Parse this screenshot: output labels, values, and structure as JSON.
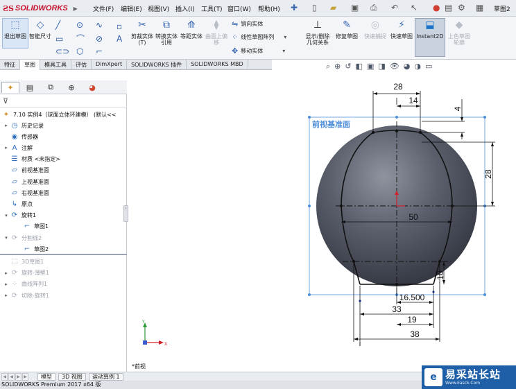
{
  "app": {
    "brand": "SOLIDWORKS",
    "document_name": "草图2",
    "brand_color": "#c8102e",
    "accent_color": "#1e5fa8"
  },
  "menu": {
    "items": [
      "文件(F)",
      "编辑(E)",
      "视图(V)",
      "插入(I)",
      "工具(T)",
      "窗口(W)",
      "帮助(H)"
    ]
  },
  "commands": {
    "exit_sketch": "退出草图",
    "smart_dim": "智能尺寸",
    "trim": "剪裁实体(T)",
    "convert": "转换实体引用",
    "offset": "等距实体",
    "surface_offset": "曲面上偏移",
    "mirror": "镜向实体",
    "linear_pattern": "线性草图阵列",
    "move": "移动实体",
    "show_delete_relations": "显示/删除几何关系",
    "repair": "修复草图",
    "quick_snap": "快速捕捉",
    "rapid_sketch": "快速草图",
    "instant2d": "Instant2D",
    "shaded_contours": "上色草图轮廓"
  },
  "tabs": {
    "items": [
      "特征",
      "草图",
      "模具工具",
      "评估",
      "DimXpert",
      "SOLIDWORKS 插件",
      "SOLIDWORKS MBD"
    ],
    "active_index": 1
  },
  "feature_tree": {
    "root": "7.10 实例4（球面立体环建模） (默认<<",
    "items": [
      {
        "label": "历史记录",
        "icon": "history-icon",
        "expand": "▸",
        "indent": 0,
        "gray": false
      },
      {
        "label": "传感器",
        "icon": "sensor-icon",
        "expand": "",
        "indent": 0,
        "gray": false
      },
      {
        "label": "注解",
        "icon": "annotation-icon",
        "expand": "▸",
        "indent": 0,
        "gray": false
      },
      {
        "label": "材质 <未指定>",
        "icon": "material-icon",
        "expand": "",
        "indent": 0,
        "gray": false
      },
      {
        "label": "前视基准面",
        "icon": "plane-icon",
        "expand": "",
        "indent": 0,
        "gray": false
      },
      {
        "label": "上视基准面",
        "icon": "plane-icon",
        "expand": "",
        "indent": 0,
        "gray": false
      },
      {
        "label": "右视基准面",
        "icon": "plane-icon",
        "expand": "",
        "indent": 0,
        "gray": false
      },
      {
        "label": "原点",
        "icon": "origin-icon",
        "expand": "",
        "indent": 0,
        "gray": false
      },
      {
        "label": "旋转1",
        "icon": "revolve-icon",
        "expand": "▾",
        "indent": 0,
        "gray": false
      },
      {
        "label": "草图1",
        "icon": "sketch-icon",
        "expand": "",
        "indent": 1,
        "gray": false
      },
      {
        "label": "分割线2",
        "icon": "split-line-icon",
        "expand": "▾",
        "indent": 0,
        "gray": true
      },
      {
        "label": "草图2",
        "icon": "sketch-icon",
        "expand": "",
        "indent": 1,
        "gray": false
      },
      {
        "label": "3D草图1",
        "icon": "sketch3d-icon",
        "expand": "",
        "indent": 0,
        "gray": true
      },
      {
        "label": "旋转-薄壁1",
        "icon": "revolve-thin-icon",
        "expand": "▸",
        "indent": 0,
        "gray": true
      },
      {
        "label": "曲线阵列1",
        "icon": "curve-pattern-icon",
        "expand": "▸",
        "indent": 0,
        "gray": true
      },
      {
        "label": "切除-旋转1",
        "icon": "cut-revolve-icon",
        "expand": "▸",
        "indent": 0,
        "gray": true
      }
    ]
  },
  "viewport": {
    "view_label": "*前视",
    "plane_label": "前视基准面",
    "dimensions": {
      "d28_top": "28",
      "d14": "14",
      "d4": "4",
      "d28_right": "28",
      "d50": "50",
      "d10": "10",
      "d16_5": "16.500",
      "d33": "33",
      "d19": "19",
      "d38": "38"
    },
    "triad": {
      "x": "X",
      "y": "Y"
    }
  },
  "bottom_tabs": {
    "items": [
      "模型",
      "3D 视图",
      "运动算例 1"
    ],
    "active_index": 0
  },
  "status": {
    "text": "SOLIDWORKS Premium 2017 x64 版"
  },
  "watermark": {
    "logo": "e",
    "title": "易采站长站",
    "url": "Www.Easck.Com"
  }
}
